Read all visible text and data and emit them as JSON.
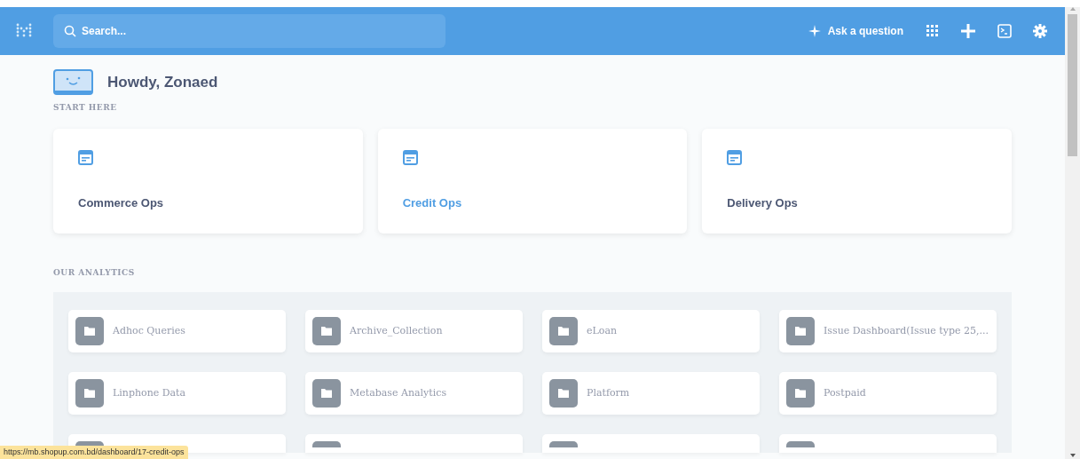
{
  "navbar": {
    "search": {
      "placeholder": "Search..."
    },
    "ask_button": "Ask a question"
  },
  "greeting": "Howdy, Zonaed",
  "start_here": {
    "heading": "START HERE",
    "dashboards": [
      {
        "title": "Commerce Ops",
        "highlighted": false
      },
      {
        "title": "Credit Ops",
        "highlighted": true
      },
      {
        "title": "Delivery Ops",
        "highlighted": false
      }
    ]
  },
  "our_analytics": {
    "heading": "OUR ANALYTICS",
    "collections": [
      {
        "kind": "full",
        "name": "Adhoc Queries"
      },
      {
        "kind": "full",
        "name": "Archive_Collection"
      },
      {
        "kind": "full",
        "name": "eLoan"
      },
      {
        "kind": "full",
        "name": "Issue Dashboard(Issue type 25,..."
      },
      {
        "kind": "full",
        "name": "Linphone Data"
      },
      {
        "kind": "full",
        "name": "Metabase Analytics"
      },
      {
        "kind": "full",
        "name": "Platform"
      },
      {
        "kind": "full",
        "name": "Postpaid"
      },
      {
        "kind": "cut"
      },
      {
        "kind": "cut"
      },
      {
        "kind": "cut"
      },
      {
        "kind": "cut"
      }
    ]
  },
  "status_url": "https://mb.shopup.com.bd/dashboard/17-credit-ops"
}
